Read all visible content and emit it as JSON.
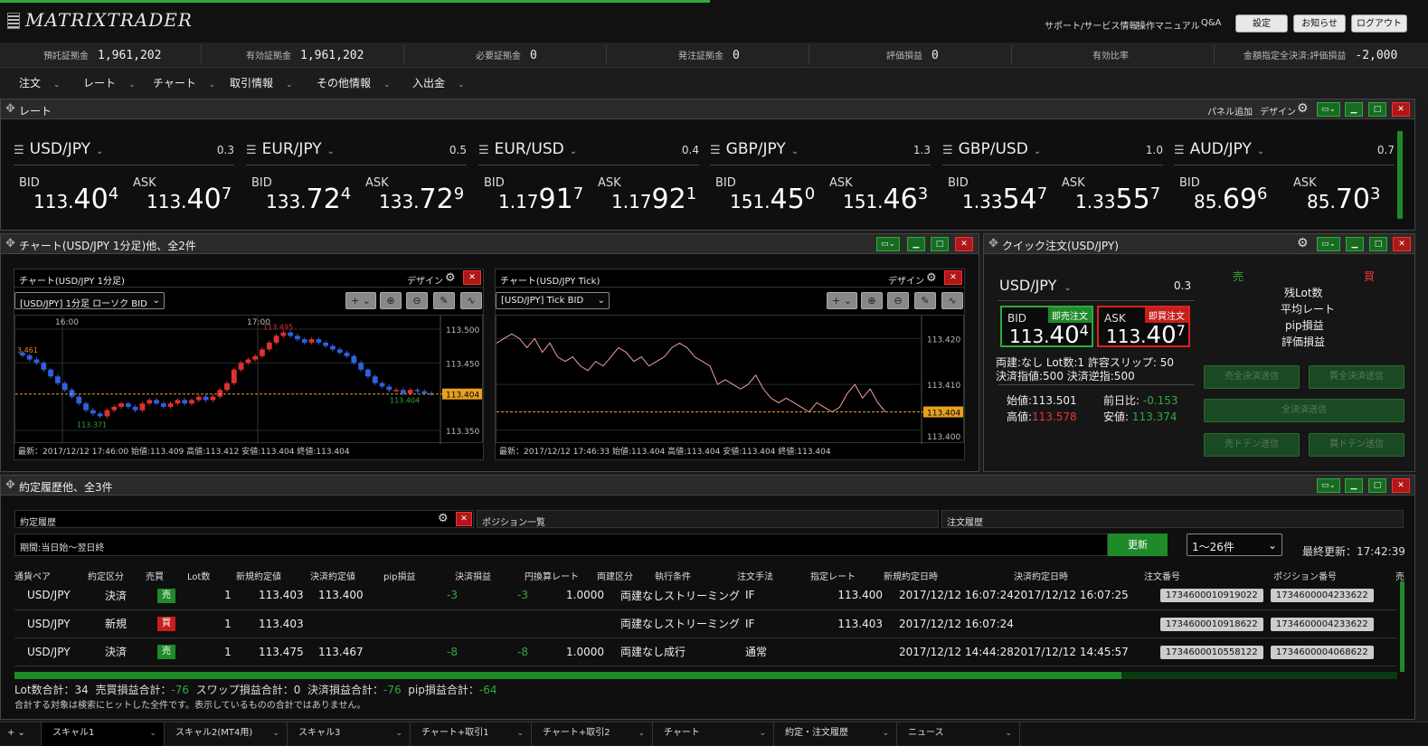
{
  "app": {
    "title": "MATRIXTRADER"
  },
  "header": {
    "links": [
      "サポート/サービス情報",
      "操作マニュアル",
      "Q&A"
    ],
    "buttons": [
      "設定",
      "お知らせ",
      "ログアウト"
    ]
  },
  "account": [
    {
      "label": "預託証拠金",
      "value": "1,961,202"
    },
    {
      "label": "有効証拠金",
      "value": "1,961,202"
    },
    {
      "label": "必要証拠金",
      "value": "0"
    },
    {
      "label": "発注証拠金",
      "value": "0"
    },
    {
      "label": "評価損益",
      "value": "0"
    },
    {
      "label": "有効比率",
      "value": ""
    },
    {
      "label": "金額指定全決済:評価損益",
      "value": "-2,000"
    }
  ],
  "menu": [
    "注文",
    "レート",
    "チャート",
    "取引情報",
    "その他情報",
    "入出金"
  ],
  "rate_panel": {
    "title": "レート",
    "add_panel": "パネル追加",
    "design": "デザイン",
    "cards": [
      {
        "pair": "USD/JPY",
        "spread": "0.3",
        "bid_label": "BID",
        "ask_label": "ASK",
        "bid": {
          "pre": "113.",
          "big": "40",
          "sup": "4"
        },
        "ask": {
          "pre": "113.",
          "big": "40",
          "sup": "7"
        }
      },
      {
        "pair": "EUR/JPY",
        "spread": "0.5",
        "bid_label": "BID",
        "ask_label": "ASK",
        "bid": {
          "pre": "133.",
          "big": "72",
          "sup": "4"
        },
        "ask": {
          "pre": "133.",
          "big": "72",
          "sup": "9"
        }
      },
      {
        "pair": "EUR/USD",
        "spread": "0.4",
        "bid_label": "BID",
        "ask_label": "ASK",
        "bid": {
          "pre": "1.17",
          "big": "91",
          "sup": "7"
        },
        "ask": {
          "pre": "1.17",
          "big": "92",
          "sup": "1"
        }
      },
      {
        "pair": "GBP/JPY",
        "spread": "1.3",
        "bid_label": "BID",
        "ask_label": "ASK",
        "bid": {
          "pre": "151.",
          "big": "45",
          "sup": "0"
        },
        "ask": {
          "pre": "151.",
          "big": "46",
          "sup": "3"
        }
      },
      {
        "pair": "GBP/USD",
        "spread": "1.0",
        "bid_label": "BID",
        "ask_label": "ASK",
        "bid": {
          "pre": "1.33",
          "big": "54",
          "sup": "7"
        },
        "ask": {
          "pre": "1.33",
          "big": "55",
          "sup": "7"
        }
      },
      {
        "pair": "AUD/JPY",
        "spread": "0.7",
        "bid_label": "BID",
        "ask_label": "ASK",
        "bid": {
          "pre": "85.",
          "big": "69",
          "sup": "6"
        },
        "ask": {
          "pre": "85.",
          "big": "70",
          "sup": "3"
        }
      }
    ]
  },
  "chart_panel": {
    "title": "チャート(USD/JPY 1分足)他、全2件",
    "left": {
      "title": "チャート(USD/JPY 1分足)",
      "design": "デザイン",
      "select": "[USD/JPY] 1分足 ローソク BID",
      "time_labels": [
        "16:00",
        "17:00"
      ],
      "price_labels": [
        "113.500",
        "113.450",
        "113.404",
        "113.350"
      ],
      "annotations": {
        "high": "113.495",
        "left": "3.461",
        "low": "113.371",
        "last": "113.404"
      },
      "footer": "最新：2017/12/12 17:46:00  始値:113.409  高値:113.412  安値:113.404  終値:113.404"
    },
    "right": {
      "title": "チャート(USD/JPY Tick)",
      "design": "デザイン",
      "select": "[USD/JPY] Tick BID",
      "price_labels": [
        "113.420",
        "113.410",
        "113.404",
        "113.400"
      ],
      "footer": "最新：2017/12/12 17:46:33  始値:113.404  高値:113.404  安値:113.404  終値:113.404"
    }
  },
  "chart_data": [
    {
      "type": "candlestick",
      "title": "チャート(USD/JPY 1分足)",
      "x_ticks": [
        "16:00",
        "17:00"
      ],
      "ylim": [
        113.33,
        113.52
      ],
      "y_ticks": [
        113.35,
        113.45,
        113.5
      ],
      "current": 113.404,
      "values": [
        113.461,
        113.455,
        113.45,
        113.44,
        113.43,
        113.42,
        113.41,
        113.4,
        113.39,
        113.38,
        113.375,
        113.371,
        113.38,
        113.385,
        113.39,
        113.385,
        113.38,
        113.39,
        113.395,
        113.39,
        113.385,
        113.39,
        113.395,
        113.39,
        113.395,
        113.4,
        113.395,
        113.4,
        113.41,
        113.42,
        113.44,
        113.45,
        113.455,
        113.46,
        113.47,
        113.48,
        113.49,
        113.495,
        113.49,
        113.485,
        113.48,
        113.485,
        113.48,
        113.475,
        113.47,
        113.465,
        113.46,
        113.45,
        113.44,
        113.43,
        113.42,
        113.415,
        113.41,
        113.41,
        113.405,
        113.41,
        113.408,
        113.405,
        113.404
      ]
    },
    {
      "type": "line",
      "title": "チャート(USD/JPY Tick)",
      "ylim": [
        113.397,
        113.425
      ],
      "y_ticks": [
        113.4,
        113.41,
        113.42
      ],
      "current": 113.404,
      "values": [
        113.419,
        113.42,
        113.421,
        113.42,
        113.418,
        113.42,
        113.417,
        113.419,
        113.416,
        113.415,
        113.416,
        113.414,
        113.413,
        113.415,
        113.414,
        113.416,
        113.418,
        113.417,
        113.415,
        113.416,
        113.414,
        113.415,
        113.416,
        113.418,
        113.419,
        113.418,
        113.416,
        113.415,
        113.414,
        113.41,
        113.411,
        113.41,
        113.409,
        113.41,
        113.412,
        113.409,
        113.407,
        113.406,
        113.407,
        113.406,
        113.405,
        113.404,
        113.406,
        113.405,
        113.404,
        113.405,
        113.408,
        113.41,
        113.407,
        113.409,
        113.406,
        113.404
      ]
    }
  ],
  "quick_order": {
    "title": "クイック注文(USD/JPY)",
    "pair": "USD/JPY",
    "spread": "0.3",
    "bid_label": "BID",
    "ask_label": "ASK",
    "sell_now": "即売注文",
    "buy_now": "即買注文",
    "bid": {
      "pre": "113.",
      "big": "40",
      "sup": "4"
    },
    "ask": {
      "pre": "113.",
      "big": "40",
      "sup": "7"
    },
    "info1": "両建:なし Lot数:1 許容スリップ: 50",
    "info2": "決済指値:500 決済逆指:500",
    "open_label": "始値:",
    "open": "113.501",
    "prev_label": "前日比:",
    "prev": "-0.153",
    "high_label": "高値:",
    "high": "113.578",
    "low_label": "安値:",
    "low": "113.374",
    "sell_head": "売",
    "buy_head": "買",
    "stats": [
      "残Lot数",
      "平均レート",
      "pip損益",
      "評価損益"
    ],
    "btn_sell_close": "売全決済送信",
    "btn_buy_close": "買全決済送信",
    "btn_all_close": "全決済送信",
    "btn_sell_doten": "売ドテン送信",
    "btn_buy_doten": "買ドテン送信"
  },
  "history": {
    "title": "約定履歴他、全3件",
    "tabs": [
      "約定履歴",
      "ポジション一覧",
      "注文履歴"
    ],
    "period": "期間:当日始〜翌日終",
    "update": "更新",
    "range": "1〜26件",
    "last_update": "最終更新：17:42:39",
    "columns": [
      "通貨ペア",
      "約定区分",
      "売買",
      "Lot数",
      "新規約定値",
      "決済約定値",
      "pip損益",
      "決済損益",
      "円換算レート",
      "両建区分",
      "執行条件",
      "注文手法",
      "指定レート",
      "新規約定日時",
      "決済約定日時",
      "注文番号",
      "ポジション番号",
      "売"
    ],
    "rows": [
      {
        "pair": "USD/JPY",
        "kind": "決済",
        "side": "売",
        "side_color": "#1f8a2a",
        "lot": "1",
        "open_rate": "113.403",
        "close_rate": "113.400",
        "pip": "-3",
        "pl": "-3",
        "conv": "1.0000",
        "hedge": "両建なし",
        "exec": "ストリーミング",
        "method": "IF",
        "spec": "113.400",
        "open_time": "2017/12/12 16:07:24",
        "close_time": "2017/12/12 16:07:25",
        "order_no": "1734600010919022",
        "pos_no": "1734600004233622"
      },
      {
        "pair": "USD/JPY",
        "kind": "新規",
        "side": "買",
        "side_color": "#c81e1e",
        "lot": "1",
        "open_rate": "113.403",
        "close_rate": "",
        "pip": "",
        "pl": "",
        "conv": "",
        "hedge": "両建なし",
        "exec": "ストリーミング",
        "method": "IF",
        "spec": "113.403",
        "open_time": "2017/12/12 16:07:24",
        "close_time": "",
        "order_no": "1734600010918622",
        "pos_no": "1734600004233622"
      },
      {
        "pair": "USD/JPY",
        "kind": "決済",
        "side": "売",
        "side_color": "#1f8a2a",
        "lot": "1",
        "open_rate": "113.475",
        "close_rate": "113.467",
        "pip": "-8",
        "pl": "-8",
        "conv": "1.0000",
        "hedge": "両建なし",
        "exec": "成行",
        "method": "通常",
        "spec": "",
        "open_time": "2017/12/12 14:44:28",
        "close_time": "2017/12/12 14:45:57",
        "order_no": "1734600010558122",
        "pos_no": "1734600004068622"
      }
    ],
    "summary": {
      "lot_label": "Lot数合計：",
      "lot": "34",
      "trade_label": "売買損益合計：",
      "trade": "-76",
      "swap_label": "スワップ損益合計：",
      "swap": "0",
      "settle_label": "決済損益合計：",
      "settle": "-76",
      "pip_label": "pip損益合計：",
      "pip": "-64"
    },
    "note": "合計する対象は検索にヒットした全件です。表示しているものの合計ではありません。"
  },
  "bottom_tabs": [
    "スキャル1",
    "スキャル2(MT4用)",
    "スキャル3",
    "チャート+取引1",
    "チャート+取引2",
    "チャート",
    "約定・注文履歴",
    "ニュース"
  ]
}
